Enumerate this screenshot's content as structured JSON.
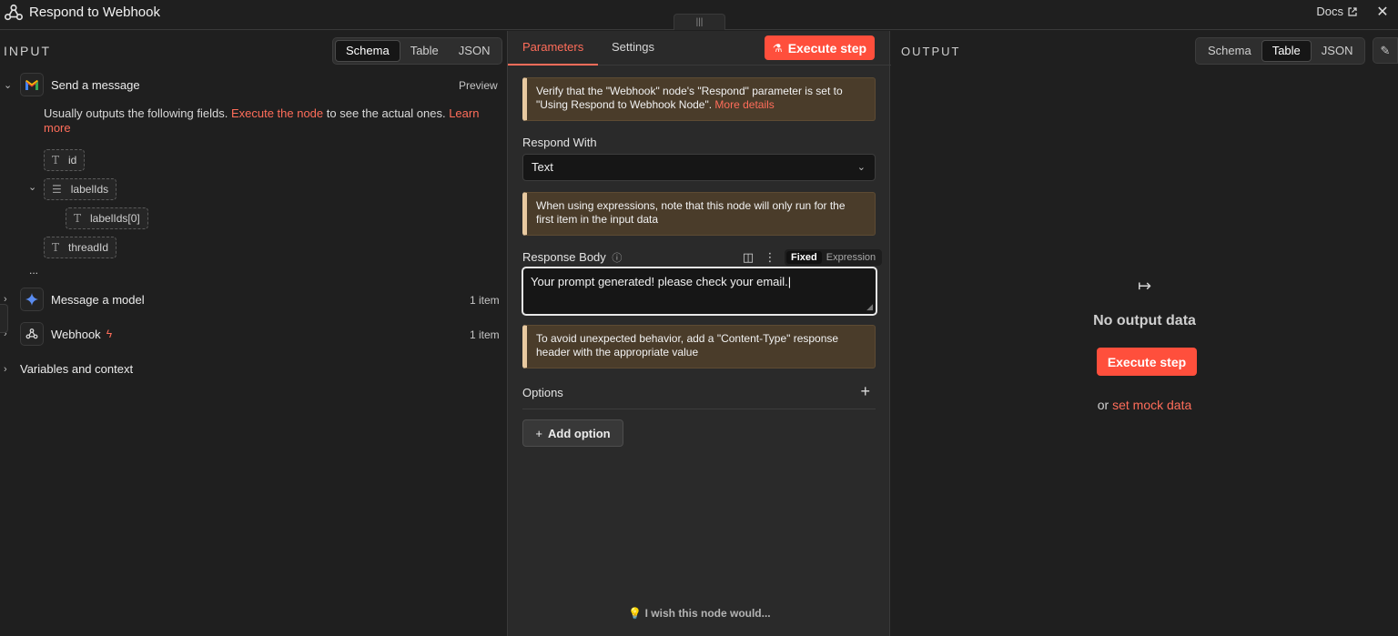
{
  "header": {
    "title": "Respond to Webhook",
    "docs_label": "Docs",
    "close_glyph": "✕",
    "logo_icon": "webhook-icon"
  },
  "input": {
    "title": "INPUT",
    "view_tabs": [
      "Schema",
      "Table",
      "JSON"
    ],
    "active_view": "Schema",
    "send_message": {
      "label": "Send a message",
      "meta": "Preview",
      "hint_prefix": "Usually outputs the following fields. ",
      "hint_link1": "Execute the node",
      "hint_middle": " to see the actual ones. ",
      "hint_link2": "Learn more",
      "fields": [
        {
          "name": "id",
          "type": "T"
        },
        {
          "name": "labelIds",
          "type": "list"
        },
        {
          "name": "labelIds[0]",
          "type": "T"
        },
        {
          "name": "threadId",
          "type": "T"
        }
      ],
      "more": "..."
    },
    "nodes": [
      {
        "label": "Message a model",
        "meta": "1 item"
      },
      {
        "label": "Webhook",
        "meta": "1 item"
      }
    ],
    "variables_label": "Variables and context"
  },
  "params": {
    "tabs": [
      "Parameters",
      "Settings"
    ],
    "active_tab": "Parameters",
    "execute_label": "Execute step",
    "notice1_text": "Verify that the \"Webhook\" node's \"Respond\" parameter is set to \"Using Respond to Webhook Node\". ",
    "notice1_link": "More details",
    "respond_with_label": "Respond With",
    "respond_with_value": "Text",
    "notice2": "When using expressions, note that this node will only run for the first item in the input data",
    "response_body_label": "Response Body",
    "mode_fixed": "Fixed",
    "mode_expression": "Expression",
    "response_body_value": "Your prompt generated! please check your email.",
    "notice3": "To avoid unexpected behavior, add a \"Content-Type\" response header with the appropriate value",
    "options_label": "Options",
    "add_option_label": "Add option",
    "wish_label": "I wish this node would..."
  },
  "output": {
    "title": "OUTPUT",
    "view_tabs": [
      "Schema",
      "Table",
      "JSON"
    ],
    "active_view": "Table",
    "empty_title": "No output data",
    "execute_label": "Execute step",
    "mock_prefix": "or ",
    "mock_link": "set mock data"
  },
  "colors": {
    "accent": "#ff6d5a",
    "primary_button": "#ff4f3c",
    "notice_bg": "#4a3c2a",
    "notice_border": "#e8c9a0"
  }
}
